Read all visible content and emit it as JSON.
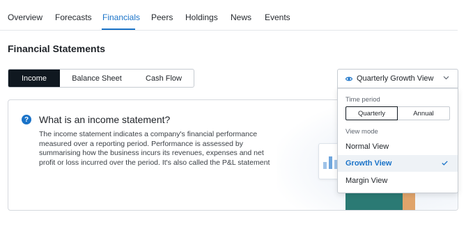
{
  "tabs": [
    {
      "label": "Overview"
    },
    {
      "label": "Forecasts"
    },
    {
      "label": "Financials"
    },
    {
      "label": "Peers"
    },
    {
      "label": "Holdings"
    },
    {
      "label": "News"
    },
    {
      "label": "Events"
    }
  ],
  "active_tab": "Financials",
  "section": {
    "title": "Financial Statements"
  },
  "statement_tabs": [
    {
      "label": "Income"
    },
    {
      "label": "Balance Sheet"
    },
    {
      "label": "Cash Flow"
    }
  ],
  "active_statement": "Income",
  "info": {
    "heading": "What is an income statement?",
    "icon_glyph": "?",
    "lines": [
      "The income statement indicates a company's financial performance",
      "measured over a reporting period. Performance is assessed by",
      "summarising how the business incurs its revenues, expenses and net",
      "profit or loss incurred over the period. It's also called the P&L statement"
    ]
  },
  "view_dropdown": {
    "label": "Quarterly Growth View",
    "icon": "eye-icon",
    "expanded": true,
    "time_period_caption": "Time period",
    "periods": [
      {
        "label": "Quarterly"
      },
      {
        "label": "Annual"
      }
    ],
    "selected_period": "Quarterly",
    "view_mode_caption": "View mode",
    "modes": [
      {
        "label": "Normal View"
      },
      {
        "label": "Growth View"
      },
      {
        "label": "Margin View"
      }
    ],
    "selected_mode": "Growth View"
  },
  "colors": {
    "accent": "#1a73c8",
    "dark_button": "#101820",
    "border": "#c6cbd1"
  }
}
